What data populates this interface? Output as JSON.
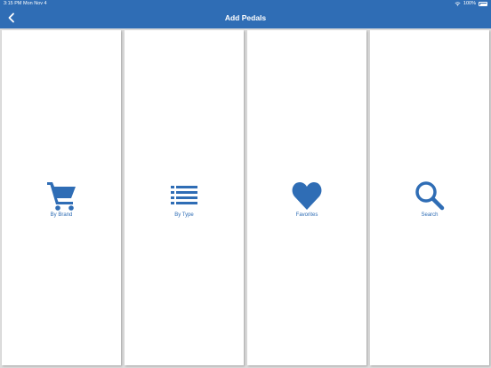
{
  "status_bar": {
    "time": "3:15 PM",
    "date": "Mon Nov 4",
    "battery": "100%"
  },
  "nav": {
    "title": "Add Pedals"
  },
  "tiles": [
    {
      "label": "By Brand",
      "icon": "cart-icon"
    },
    {
      "label": "By Type",
      "icon": "list-icon"
    },
    {
      "label": "Favorites",
      "icon": "heart-icon"
    },
    {
      "label": "Search",
      "icon": "search-icon"
    }
  ],
  "colors": {
    "brand": "#2f6db5",
    "background": "#dcdcdc",
    "tile": "#ffffff"
  }
}
